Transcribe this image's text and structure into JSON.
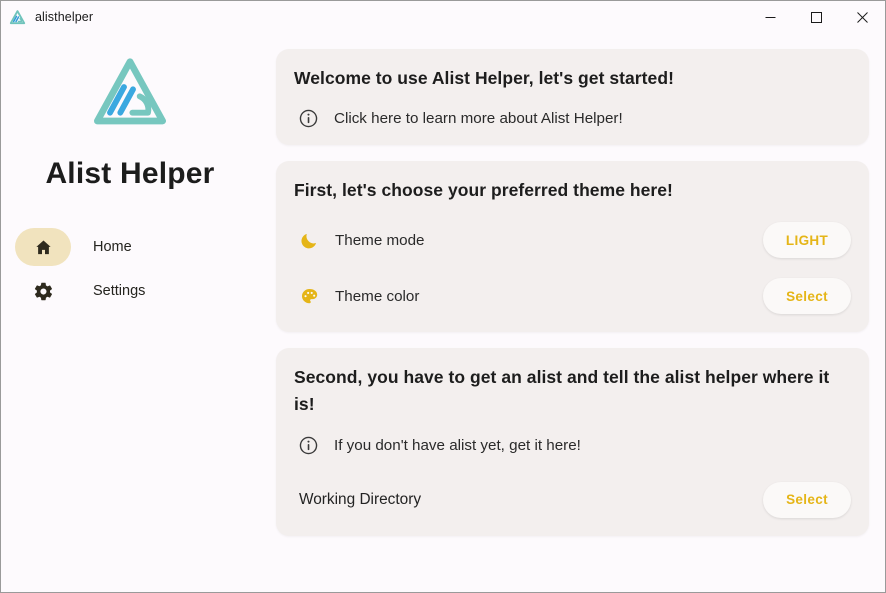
{
  "window": {
    "title": "alisthelper",
    "app_icon": "alist-triangle-icon",
    "controls": {
      "minimize_label": "Minimize",
      "maximize_label": "Maximize",
      "close_label": "Close"
    }
  },
  "sidebar": {
    "logo_icon": "alist-triangle-logo",
    "app_name": "Alist Helper",
    "items": [
      {
        "label": "Home",
        "icon": "home-icon",
        "selected": true
      },
      {
        "label": "Settings",
        "icon": "gear-icon",
        "selected": false
      }
    ]
  },
  "cards": {
    "welcome": {
      "title": "Welcome to use Alist Helper, let's get started!",
      "link_icon": "info-icon",
      "link_text": "Click here to learn more about Alist Helper!"
    },
    "theme": {
      "title": "First, let's choose your preferred theme here!",
      "rows": [
        {
          "icon": "moon-icon",
          "label": "Theme mode",
          "button": "LIGHT"
        },
        {
          "icon": "palette-icon",
          "label": "Theme color",
          "button": "Select"
        }
      ]
    },
    "alist": {
      "title": "Second, you have to get an alist and tell the alist helper where it is!",
      "link_icon": "info-icon",
      "link_text": "If you don't have alist yet, get it here!",
      "directory_label": "Working Directory",
      "directory_button": "Select"
    }
  },
  "colors": {
    "page_background": "#FDFAFD",
    "card_background": "#F3EFEE",
    "accent_gold": "#E5B517",
    "selected_pill": "#F1E3BE",
    "logo_teal": "#72C6BE",
    "logo_blue": "#3AA3DE",
    "text_primary": "#1D1D1D"
  }
}
